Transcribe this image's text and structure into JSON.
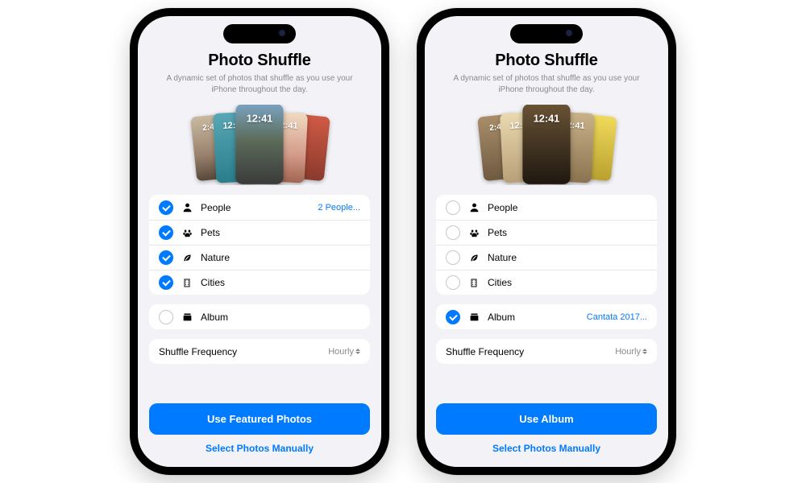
{
  "title": "Photo Shuffle",
  "subtitle": "A dynamic set of photos that shuffle as you use your iPhone throughout the day.",
  "preview_time": "12:41",
  "preview_time_small": "2:41",
  "categories": [
    {
      "key": "people",
      "label": "People",
      "detail_left": "2 People..."
    },
    {
      "key": "pets",
      "label": "Pets"
    },
    {
      "key": "nature",
      "label": "Nature"
    },
    {
      "key": "cities",
      "label": "Cities"
    }
  ],
  "album_label": "Album",
  "album_selected_name": "Cantata 2017...",
  "frequency_label": "Shuffle Frequency",
  "frequency_value": "Hourly",
  "primary_left": "Use Featured Photos",
  "primary_right": "Use Album",
  "secondary": "Select Photos Manually"
}
